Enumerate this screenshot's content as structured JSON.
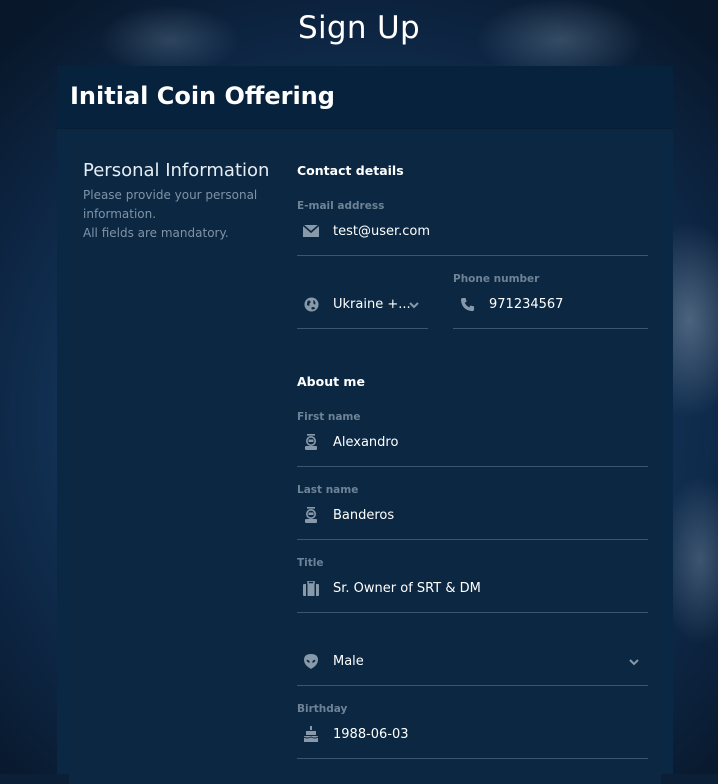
{
  "page": {
    "title": "Sign Up"
  },
  "card": {
    "heading": "Initial Coin Offering"
  },
  "personal": {
    "title": "Personal Information",
    "description": [
      "Please provide your personal",
      "information.",
      "All fields are mandatory."
    ]
  },
  "contact": {
    "title": "Contact details",
    "email": {
      "label": "E-mail address",
      "value": "test@user.com",
      "icon": "envelope-icon"
    },
    "country": {
      "value": "Ukraine +...",
      "icon": "globe-icon"
    },
    "phone": {
      "label": "Phone number",
      "value": "971234567",
      "icon": "phone-icon"
    }
  },
  "about": {
    "title": "About me",
    "first_name": {
      "label": "First name",
      "value": "Alexandro",
      "icon": "astronaut-icon"
    },
    "last_name": {
      "label": "Last name",
      "value": "Banderos",
      "icon": "astronaut-icon"
    },
    "job_title": {
      "label": "Title",
      "value": "Sr. Owner of  SRT & DM",
      "icon": "briefcase-icon"
    },
    "gender": {
      "value": "Male",
      "icon": "alien-icon"
    },
    "birthday": {
      "label": "Birthday",
      "value": "1988-06-03",
      "icon": "cake-icon"
    }
  },
  "colors": {
    "card_bg": "#0a2844",
    "header_bg": "#07223c",
    "label": "#6f8397",
    "underline": "#3b5672",
    "icon": "#8899aa"
  }
}
